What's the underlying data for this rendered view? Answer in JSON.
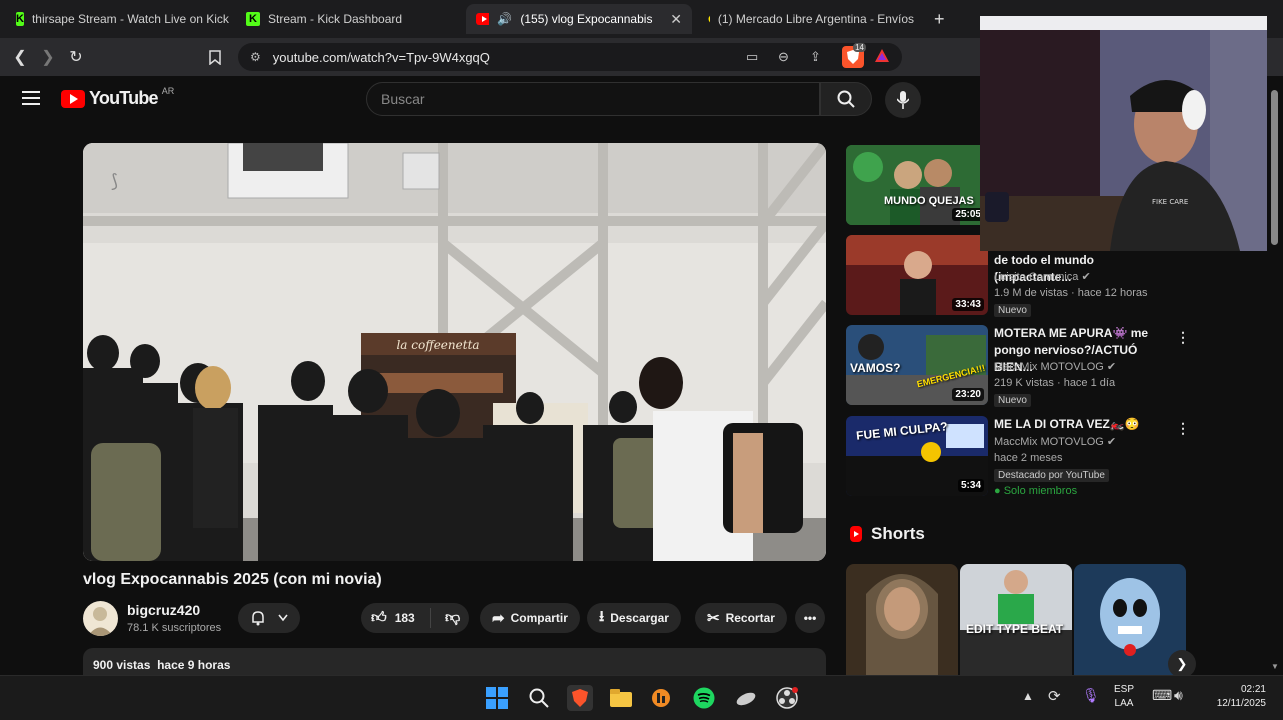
{
  "browser": {
    "tabs": [
      {
        "title": "thirsape Stream - Watch Live on Kick"
      },
      {
        "title": "Stream - Kick Dashboard"
      },
      {
        "title": "(155) vlog Expocannabis 2025"
      },
      {
        "title": "(1) Mercado Libre Argentina - Envíos"
      }
    ],
    "url": "youtube.com/watch?v=Tpv-9W4xgqQ",
    "brave_badge": "14"
  },
  "youtube": {
    "logo": "YouTube",
    "region": "AR",
    "search_placeholder": "Buscar"
  },
  "video": {
    "title": "vlog Expocannabis 2025 (con mi novia)",
    "cafe_sign": "la coffeenetta",
    "channel": "bigcruz420",
    "subscribers": "78.1 K suscriptores",
    "likes": "183",
    "share": "Compartir",
    "download": "Descargar",
    "clip": "Recortar",
    "views": "900 vistas",
    "age": "hace 9 horas"
  },
  "recommendations": [
    {
      "duration": "25:05",
      "thumb_text": "MUNDO QUEJAS"
    },
    {
      "title": "de todo el mundo (impactante...",
      "channel": "Luisito Comunica",
      "meta": "1.9 M de vistas · hace 12 horas",
      "badge": "Nuevo",
      "duration": "33:43"
    },
    {
      "title": "MOTERA ME APURA👾 me pongo nervioso?/ACTUÓ BIEN...",
      "channel": "MaccMix MOTOVLOG",
      "meta": "219 K vistas · hace 1 día",
      "badge": "Nuevo",
      "duration": "23:20",
      "thumb_text": "VAMOS?",
      "thumb_text2": "EMERGENCIA!!!"
    },
    {
      "title": "ME LA DI OTRA VEZ🏍️😳",
      "channel": "MaccMix MOTOVLOG",
      "meta": "hace 2 meses",
      "badge": "Destacado por YouTube",
      "members": "Solo miembros",
      "duration": "5:34",
      "thumb_text": "FUE MI CULPA?"
    }
  ],
  "shorts": {
    "heading": "Shorts",
    "items": [
      {
        "caption": ""
      },
      {
        "caption": "EDIT TYPE BEAT"
      },
      {
        "caption": ""
      }
    ]
  },
  "webcam": {
    "shirt_text": "FIKE CARE"
  },
  "taskbar": {
    "lang": "ESP",
    "layout": "LAA",
    "time": "02:21",
    "date": "12/11/2025"
  },
  "colors": {
    "yt_red": "#ff0000",
    "kick_green": "#53fc18",
    "background": "#0f0f0f"
  }
}
